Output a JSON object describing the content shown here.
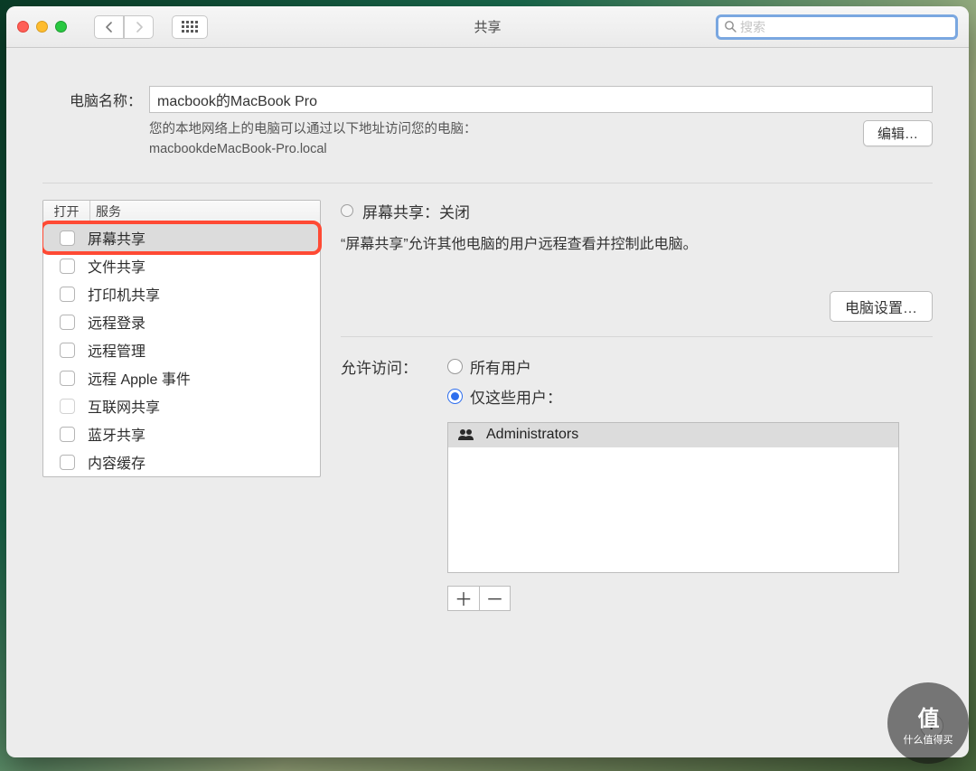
{
  "window": {
    "title": "共享",
    "search_placeholder": "搜索"
  },
  "computerName": {
    "label": "电脑名称：",
    "value": "macbook的MacBook Pro",
    "desc_line1": "您的本地网络上的电脑可以通过以下地址访问您的电脑：",
    "desc_line2": "macbookdeMacBook-Pro.local",
    "edit_label": "编辑…"
  },
  "sidebar": {
    "col_open": "打开",
    "col_service": "服务",
    "items": [
      {
        "label": "屏幕共享",
        "checked": false,
        "selected": true
      },
      {
        "label": "文件共享",
        "checked": false
      },
      {
        "label": "打印机共享",
        "checked": false
      },
      {
        "label": "远程登录",
        "checked": false
      },
      {
        "label": "远程管理",
        "checked": false
      },
      {
        "label": "远程 Apple 事件",
        "checked": false
      },
      {
        "label": "互联网共享",
        "checked": false,
        "disabled": true
      },
      {
        "label": "蓝牙共享",
        "checked": false
      },
      {
        "label": "内容缓存",
        "checked": false
      }
    ]
  },
  "rightPane": {
    "status_title": "屏幕共享：关闭",
    "status_desc": "“屏幕共享”允许其他电脑的用户远程查看并控制此电脑。",
    "computer_settings": "电脑设置…",
    "access_label": "允许访问：",
    "radio_all": "所有用户",
    "radio_only": "仅这些用户：",
    "user_list": [
      "Administrators"
    ],
    "plus": "＋",
    "minus": "－"
  },
  "help": "?",
  "watermark": {
    "big": "值",
    "small": "什么值得买"
  }
}
